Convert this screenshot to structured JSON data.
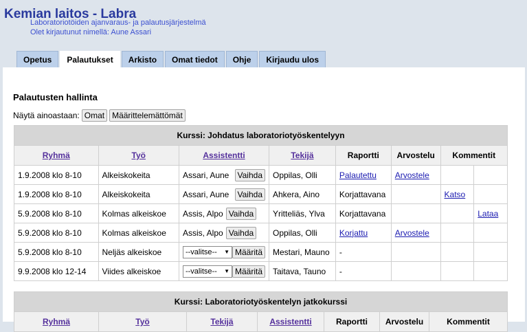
{
  "header": {
    "title": "Kemian laitos - Labra",
    "subtitle": "Laboratoriotöiden ajanvaraus- ja palautusjärjestelmä",
    "logged_in": "Olet kirjautunut nimellä: Aune Assari"
  },
  "tabs": [
    {
      "label": "Opetus",
      "active": false
    },
    {
      "label": "Palautukset",
      "active": true
    },
    {
      "label": "Arkisto",
      "active": false
    },
    {
      "label": "Omat tiedot",
      "active": false
    },
    {
      "label": "Ohje",
      "active": false
    },
    {
      "label": "Kirjaudu ulos",
      "active": false
    }
  ],
  "main": {
    "section_title": "Palautusten hallinta",
    "filter_label": "Näytä ainoastaan:",
    "filter_own": "Omat",
    "filter_undefined": "Määrittelemättömät"
  },
  "course1": {
    "caption": "Kurssi: Johdatus laboratoriotyöskentelyyn",
    "headers": [
      "Ryhmä",
      "Työ",
      "Assistentti",
      "Tekijä",
      "Raportti",
      "Arvostelu",
      "Kommentit"
    ],
    "rows": [
      {
        "group": "1.9.2008 klo 8-10",
        "work": "Alkeiskokeita",
        "assistant": "Assari, Aune",
        "assistant_action": "Vaihda",
        "author": "Oppilas, Olli",
        "report": "Palautettu",
        "report_link": true,
        "grading": "Arvostele",
        "comment1": "",
        "comment2": ""
      },
      {
        "group": "1.9.2008 klo 8-10",
        "work": "Alkeiskokeita",
        "assistant": "Assari, Aune",
        "assistant_action": "Vaihda",
        "author": "Ahkera, Aino",
        "report": "Korjattavana",
        "report_link": false,
        "grading": "",
        "comment1": "Katso",
        "comment2": ""
      },
      {
        "group": "5.9.2008 klo 8-10",
        "work": "Kolmas alkeiskoe",
        "assistant": "Assis, Alpo",
        "assistant_action": "Vaihda",
        "author": "Yritteliäs, Ylva",
        "report": "Korjattavana",
        "report_link": false,
        "grading": "",
        "comment1": "",
        "comment2": "Lataa"
      },
      {
        "group": "5.9.2008 klo 8-10",
        "work": "Kolmas alkeiskoe",
        "assistant": "Assis, Alpo",
        "assistant_action": "Vaihda",
        "author": "Oppilas, Olli",
        "report": "Korjattu",
        "report_link": true,
        "grading": "Arvostele",
        "comment1": "",
        "comment2": ""
      },
      {
        "group": "5.9.2008 klo 8-10",
        "work": "Neljäs alkeiskoe",
        "assistant": "",
        "select_value": "--valitse--",
        "assistant_action": "Määritä",
        "author": "Mestari, Mauno",
        "report": "-",
        "report_link": false,
        "grading": "",
        "comment1": "",
        "comment2": ""
      },
      {
        "group": "9.9.2008 klo 12-14",
        "work": "Viides alkeiskoe",
        "assistant": "",
        "select_value": "--valitse--",
        "assistant_action": "Määritä",
        "author": "Taitava, Tauno",
        "report": "-",
        "report_link": false,
        "grading": "",
        "comment1": "",
        "comment2": ""
      }
    ]
  },
  "course2": {
    "caption": "Kurssi: Laboratoriotyöskentelyn jatkokurssi",
    "headers": [
      "Ryhmä",
      "Työ",
      "Tekijä",
      "Assistentti",
      "Raportti",
      "Arvostelu",
      "Kommentit"
    ]
  },
  "colors": {
    "tab_bg": "#bcd0ea",
    "title": "#2a3a9e",
    "link": "#1a1ab0",
    "page_bg": "#dde4ec"
  }
}
